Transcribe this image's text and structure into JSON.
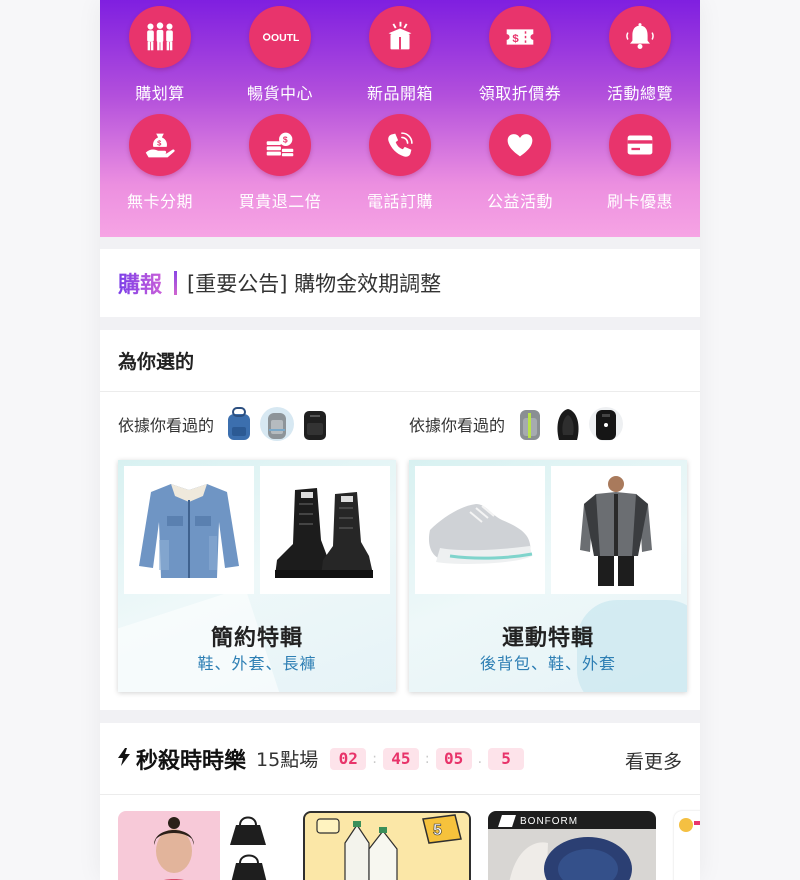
{
  "icon_grid": {
    "items": [
      {
        "label": "購划算",
        "icon": "people-group-icon"
      },
      {
        "label": "暢貨中心",
        "icon": "outlet-icon",
        "icon_text": "OUTLET"
      },
      {
        "label": "新品開箱",
        "icon": "gift-box-icon"
      },
      {
        "label": "領取折價券",
        "icon": "coupon-icon",
        "icon_text": "$"
      },
      {
        "label": "活動總覽",
        "icon": "bell-icon"
      },
      {
        "label": "無卡分期",
        "icon": "money-bag-hand-icon"
      },
      {
        "label": "買貴退二倍",
        "icon": "coins-stack-icon"
      },
      {
        "label": "電話訂購",
        "icon": "phone-icon"
      },
      {
        "label": "公益活動",
        "icon": "heart-icon"
      },
      {
        "label": "刷卡優惠",
        "icon": "credit-card-icon"
      }
    ],
    "colors": {
      "circle": "#e8346c",
      "gradient_top": "#7f1fe0",
      "gradient_bottom": "#f6a4e4"
    }
  },
  "notice": {
    "brand": "購報",
    "text": "[重要公告] 購物金效期調整"
  },
  "for_you": {
    "title": "為你選的",
    "basis_left": "依據你看過的",
    "basis_right": "依據你看過的",
    "cards": [
      {
        "title": "簡約特輯",
        "subtitle": "鞋、外套、長褲",
        "products": [
          "denim-jacket-image",
          "black-boots-image"
        ]
      },
      {
        "title": "運動特輯",
        "subtitle": "後背包、鞋、外套",
        "products": [
          "grey-sneaker-image",
          "sport-jacket-model-image"
        ]
      }
    ],
    "accent_color": "#2e7fb4"
  },
  "flash_sale": {
    "title": "秒殺時時樂",
    "time_slot": "15點場",
    "countdown": [
      "02",
      "45",
      "05",
      "5"
    ],
    "more": "看更多",
    "tile_brand": "BONFORM",
    "tile_badge": "5",
    "countdown_color": "#e8336a"
  }
}
